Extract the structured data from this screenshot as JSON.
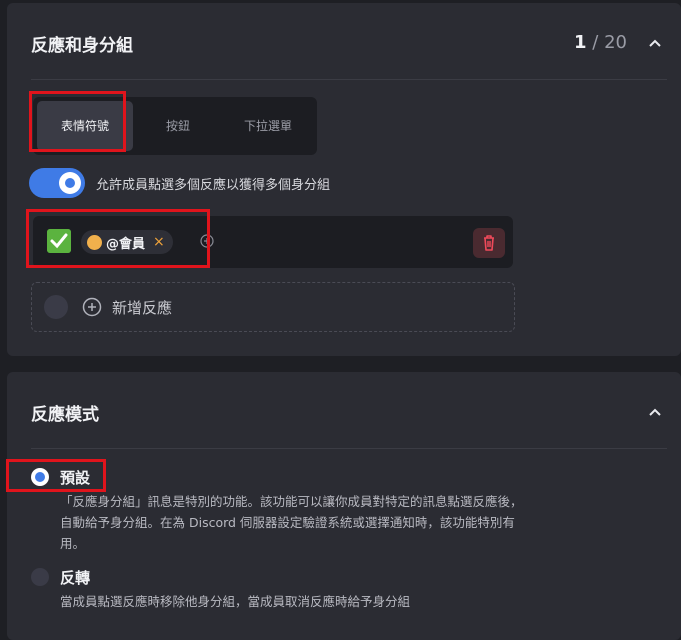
{
  "reaction_roles": {
    "title": "反應和身分組",
    "count_current": "1",
    "count_rest": "/ 20",
    "tabs": [
      {
        "label": "表情符號",
        "active": true
      },
      {
        "label": "按鈕",
        "active": false
      },
      {
        "label": "下拉選單",
        "active": false
      }
    ],
    "toggle": {
      "label": "允許成員點選多個反應以獲得多個身分組",
      "on": true
    },
    "reaction": {
      "emoji": "white-check-mark",
      "role": "@會員",
      "role_color": "#f1b04c",
      "remove_symbol": "×"
    },
    "add_reaction_label": "新增反應"
  },
  "reaction_mode": {
    "title": "反應模式",
    "options": [
      {
        "label": "預設",
        "selected": true,
        "desc": "「反應身分組」訊息是特別的功能。該功能可以讓你成員對特定的訊息點選反應後，自動給予身分組。在為 Discord 伺服器設定驗證系統或選擇通知時，該功能特別有用。"
      },
      {
        "label": "反轉",
        "selected": false,
        "desc": "當成員點選反應時移除他身分組，當成員取消反應時給予身分組"
      }
    ]
  },
  "colors": {
    "accent": "#3f7be6",
    "highlight": "#e0141c",
    "danger": "#f04a5a"
  }
}
